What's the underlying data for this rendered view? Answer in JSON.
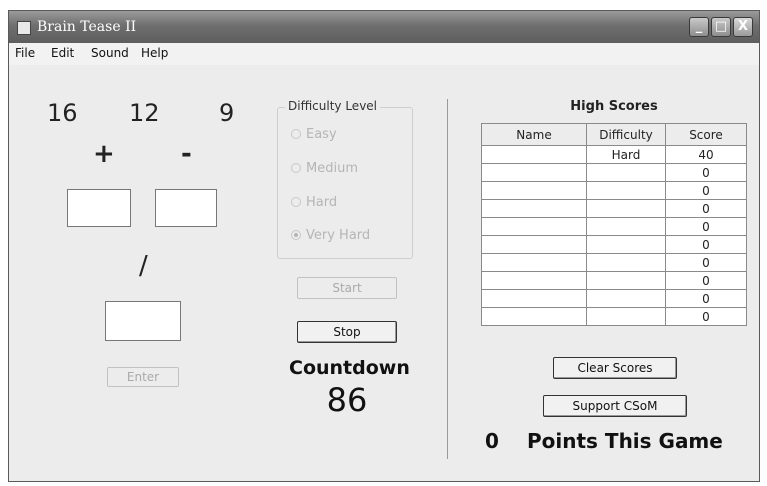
{
  "window": {
    "title": "Brain Tease II"
  },
  "titlebar_buttons": {
    "minimize": "_",
    "maximize": "□",
    "close": "X"
  },
  "menu": [
    "File",
    "Edit",
    "Sound",
    "Help"
  ],
  "puzzle": {
    "numbers": [
      "16",
      "12",
      "9"
    ],
    "operators": [
      "+",
      "-",
      "/"
    ],
    "enter_label": "Enter"
  },
  "difficulty": {
    "title": "Difficulty Level",
    "options": [
      "Easy",
      "Medium",
      "Hard",
      "Very Hard"
    ],
    "selected": "Very Hard"
  },
  "controls": {
    "start_label": "Start",
    "stop_label": "Stop"
  },
  "countdown": {
    "label": "Countdown",
    "value": "86"
  },
  "high_scores": {
    "title": "High Scores",
    "columns": [
      "Name",
      "Difficulty",
      "Score"
    ],
    "rows": [
      [
        "",
        "Hard",
        "40"
      ],
      [
        "",
        "",
        "0"
      ],
      [
        "",
        "",
        "0"
      ],
      [
        "",
        "",
        "0"
      ],
      [
        "",
        "",
        "0"
      ],
      [
        "",
        "",
        "0"
      ],
      [
        "",
        "",
        "0"
      ],
      [
        "",
        "",
        "0"
      ],
      [
        "",
        "",
        "0"
      ],
      [
        "",
        "",
        "0"
      ]
    ]
  },
  "buttons": {
    "clear_scores": "Clear Scores",
    "support": "Support CSoM"
  },
  "points": {
    "value": "0",
    "label": "Points This Game"
  }
}
